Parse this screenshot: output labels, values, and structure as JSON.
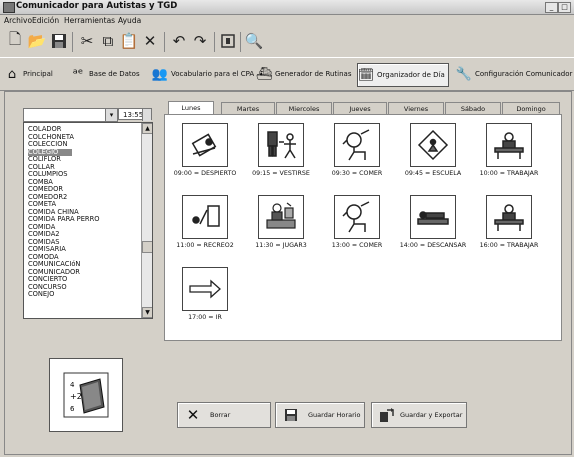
{
  "window": {
    "title": "Comunicador para Autistas y TGD"
  },
  "menu": [
    "Archivo",
    "Edición",
    "Herramientas",
    "Ayuda"
  ],
  "toolbar_icons": [
    "new-file-icon",
    "open-folder-icon",
    "save-icon",
    "cut-icon",
    "copy-icon",
    "paste-icon",
    "delete-icon",
    "undo-icon",
    "redo-icon",
    "stop-icon",
    "search-icon"
  ],
  "nav_tabs": [
    {
      "label": "Principal",
      "icon": "house-icon"
    },
    {
      "label": "Base de Datos",
      "icon": "database-icon"
    },
    {
      "label": "Vocabulario para el CPA",
      "icon": "people-icon"
    },
    {
      "label": "Generador de Rutinas",
      "icon": "ship-icon"
    },
    {
      "label": "Organizador de Día",
      "icon": "calendar-icon"
    },
    {
      "label": "Configuración Comunicador",
      "icon": "wrench-icon"
    }
  ],
  "time_value": "13:55",
  "word_list": [
    "COLADOR",
    "COLCHONETA",
    "COLECCION",
    "COLEGIO",
    "COLIFLOR",
    "COLLAR",
    "COLUMPIOS",
    "COMBA",
    "COMEDOR",
    "COMEDOR2",
    "COMETA",
    "COMIDA CHINA",
    "COMIDA PARA PERRO",
    "COMIDA",
    "COMIDA2",
    "COMIDAS",
    "COMISARIA",
    "COMODA",
    "COMUNICACIóN",
    "COMUNICADOR",
    "CONCIERTO",
    "CONCURSO",
    "CONEJO"
  ],
  "selected_word": "COLEGIO",
  "day_tabs": [
    "Lunes",
    "Martes",
    "Miercoles",
    "Jueves",
    "Viernes",
    "Sábado",
    "Domingo"
  ],
  "active_day": "Lunes",
  "schedule": [
    {
      "caption": "09:00 = DESPIERTO",
      "icon": "wake-up-pictogram"
    },
    {
      "caption": "09:15 = VESTIRSE",
      "icon": "get-dressed-pictogram"
    },
    {
      "caption": "09:30 = COMER",
      "icon": "eat-pictogram"
    },
    {
      "caption": "09:45 = ESCUELA",
      "icon": "school-pictogram"
    },
    {
      "caption": "10:00 = TRABAJAR",
      "icon": "work-desk-pictogram"
    },
    {
      "caption": "11:00 = RECREO2",
      "icon": "recess-pictogram"
    },
    {
      "caption": "11:30 = JUGAR3",
      "icon": "play-pictogram"
    },
    {
      "caption": "13:00 = COMER",
      "icon": "eat-pictogram"
    },
    {
      "caption": "14:00 = DESCANSAR",
      "icon": "rest-pictogram"
    },
    {
      "caption": "16:00 = TRABAJAR",
      "icon": "work-desk-pictogram"
    },
    {
      "caption": "17:00 = IR",
      "icon": "go-arrow-pictogram"
    }
  ],
  "buttons": {
    "delete": "Borrar",
    "save_schedule": "Guardar Horario",
    "save_export": "Guardar y Exportar"
  }
}
